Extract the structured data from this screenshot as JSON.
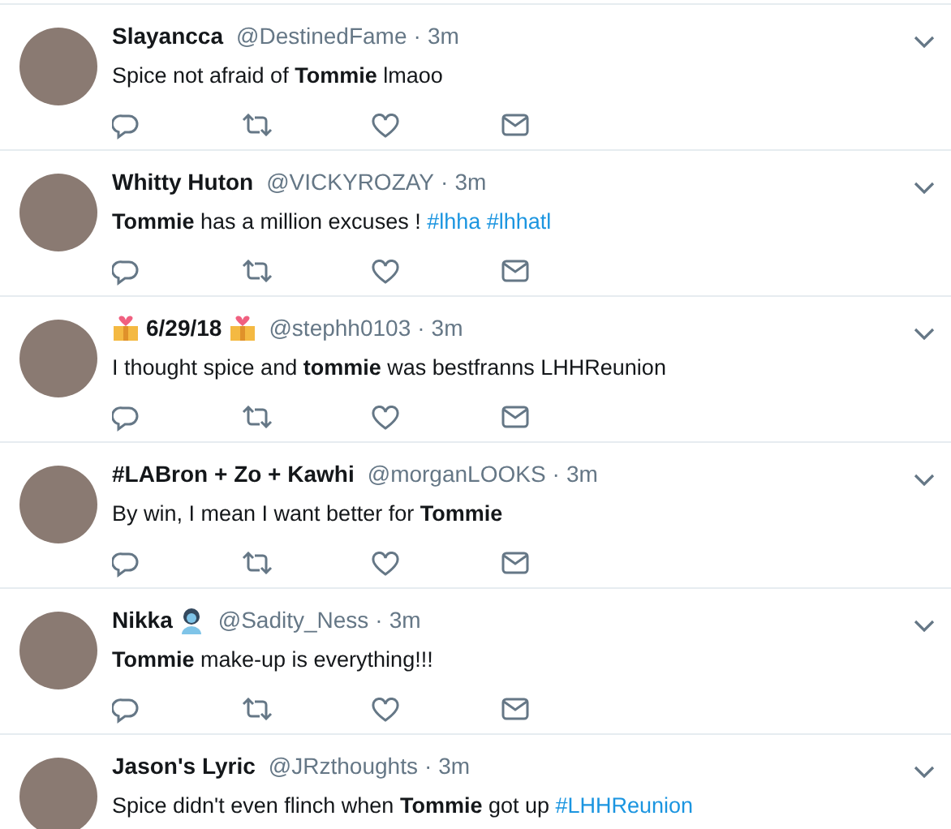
{
  "tweets": [
    {
      "name_parts": [
        {
          "kind": "text",
          "text": "Slayancca"
        }
      ],
      "handle": "@DestinedFame",
      "separator": "·",
      "time": "3m",
      "text": "Spice not afraid of **Tommie** lmaoo"
    },
    {
      "name_parts": [
        {
          "kind": "text",
          "text": "Whitty Huton"
        }
      ],
      "handle": "@VICKYROZAY",
      "separator": "·",
      "time": "3m",
      "text": "**Tommie** has a million excuses !",
      "hashtags": [
        "#lhha",
        "#lhhatl"
      ]
    },
    {
      "name_parts": [
        {
          "kind": "gift"
        },
        {
          "kind": "text",
          "text": "6/29/18"
        },
        {
          "kind": "gift"
        }
      ],
      "handle": "@stephh0103",
      "separator": "·",
      "time": "3m",
      "text": "I thought spice and **tommie** was bestfranns LHHReunion"
    },
    {
      "name_parts": [
        {
          "kind": "text",
          "text": "#LABron + Zo + Kawhi"
        }
      ],
      "handle": "@morganLOOKS",
      "separator": "·",
      "time": "3m",
      "text": "By win, I mean I want better for **Tommie**"
    },
    {
      "name_parts": [
        {
          "kind": "text",
          "text": "Nikka"
        },
        {
          "kind": "person"
        }
      ],
      "handle": "@Sadity_Ness",
      "separator": "·",
      "time": "3m",
      "text": "**Tommie** make-up is everything!!!"
    },
    {
      "name_parts": [
        {
          "kind": "text",
          "text": "Jason's Lyric"
        }
      ],
      "handle": "@JRzthoughts",
      "separator": "·",
      "time": "3m",
      "text": "Spice didn't even flinch when **Tommie** got up",
      "hashtags": [
        "#LHHReunion"
      ]
    }
  ]
}
